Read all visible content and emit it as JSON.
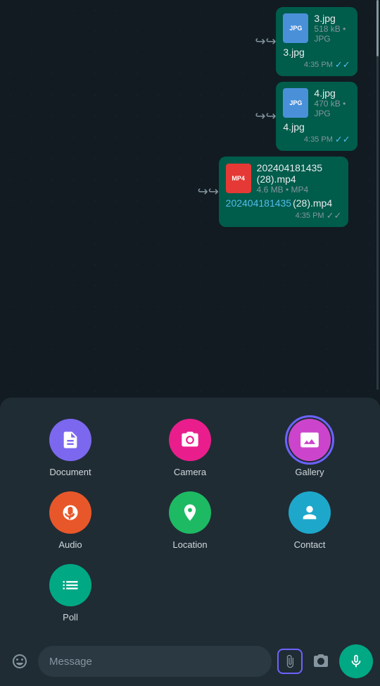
{
  "messages": [
    {
      "id": "msg1",
      "fileIcon": "JPG",
      "fileType": "jpg",
      "fileName": "3.jpg",
      "fileMeta": "518 kB • JPG",
      "displayName": "3.jpg",
      "time": "4:35 PM",
      "hasCheck": true
    },
    {
      "id": "msg2",
      "fileIcon": "JPG",
      "fileType": "jpg",
      "fileName": "4.jpg",
      "fileMeta": "470 kB • JPG",
      "displayName": "4.jpg",
      "time": "4:35 PM",
      "hasCheck": true
    },
    {
      "id": "msg3",
      "fileIcon": "MP4",
      "fileType": "mp4",
      "fileName": "202404181435 (28).mp4",
      "fileMeta": "4.6 MB • MP4",
      "displayName": "202404181435",
      "displayName2": "(28).mp4",
      "time": "4:35 PM",
      "hasCheck": false,
      "isLink": true
    }
  ],
  "attachMenu": {
    "items": [
      {
        "id": "document",
        "label": "Document",
        "color": "#7b68ee",
        "icon": "📄",
        "selected": false
      },
      {
        "id": "camera",
        "label": "Camera",
        "color": "#e91e8c",
        "icon": "📷",
        "selected": false
      },
      {
        "id": "gallery",
        "label": "Gallery",
        "color": "#cc44cc",
        "icon": "🖼",
        "selected": true
      },
      {
        "id": "audio",
        "label": "Audio",
        "color": "#e8572a",
        "icon": "🎧",
        "selected": false
      },
      {
        "id": "location",
        "label": "Location",
        "color": "#1dba63",
        "icon": "📍",
        "selected": false
      },
      {
        "id": "contact",
        "label": "Contact",
        "color": "#1da8cb",
        "icon": "👤",
        "selected": false
      },
      {
        "id": "poll",
        "label": "Poll",
        "color": "#00a884",
        "icon": "≡",
        "selected": false
      }
    ]
  },
  "bottomBar": {
    "placeholder": "Message",
    "emojiIcon": "emoji-icon",
    "attachIcon": "attach-icon",
    "cameraIcon": "camera-icon",
    "micIcon": "mic-icon"
  }
}
